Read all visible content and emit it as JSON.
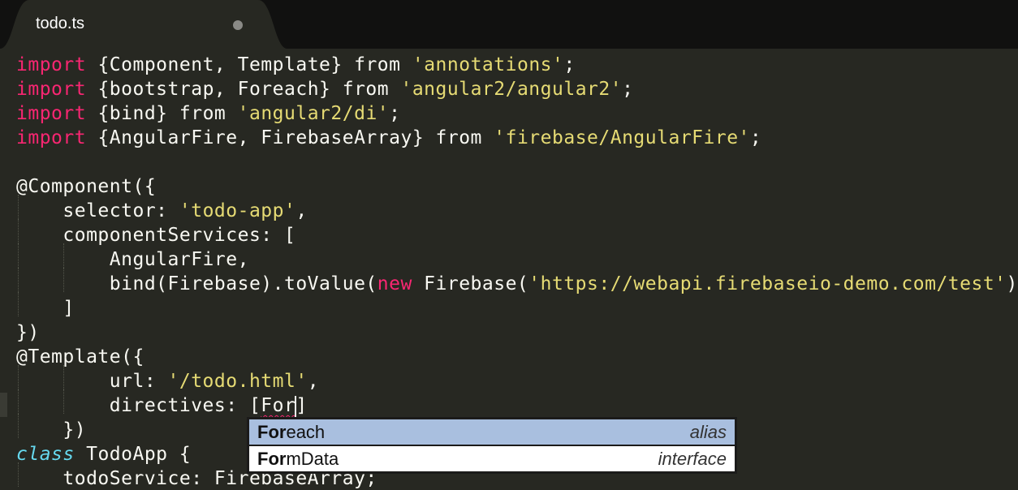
{
  "tab": {
    "title": "todo.ts"
  },
  "code": {
    "l1": [
      "import",
      " {Component, Template} ",
      "from",
      " ",
      "'annotations'",
      ";"
    ],
    "l2": [
      "import",
      " {bootstrap, Foreach} ",
      "from",
      " ",
      "'angular2/angular2'",
      ";"
    ],
    "l3": [
      "import",
      " {bind} ",
      "from",
      " ",
      "'angular2/di'",
      ";"
    ],
    "l4": [
      "import",
      " {AngularFire, FirebaseArray} ",
      "from",
      " ",
      "'firebase/AngularFire'",
      ";"
    ],
    "l6": "@Component({",
    "l7": [
      "    selector: ",
      "'todo-app'",
      ","
    ],
    "l8": "    componentServices: [",
    "l9": "        AngularFire,",
    "l10": [
      "        bind(Firebase).toValue(",
      "new",
      " Firebase(",
      "'https://webapi.firebaseio-demo.com/test'",
      "))"
    ],
    "l11": "    ]",
    "l12": "})",
    "l13": "@Template({",
    "l14": [
      "        url: ",
      "'/todo.html'",
      ","
    ],
    "l15": [
      "        directives: [",
      "For",
      "]"
    ],
    "l16": "    })",
    "l17": [
      "class",
      " TodoApp {"
    ],
    "l18": "    todoService: FirebaseArray;"
  },
  "autocomplete": {
    "items": [
      {
        "match": "For",
        "rest": "each",
        "kind": "alias"
      },
      {
        "match": "For",
        "rest": "mData",
        "kind": "interface"
      }
    ]
  }
}
